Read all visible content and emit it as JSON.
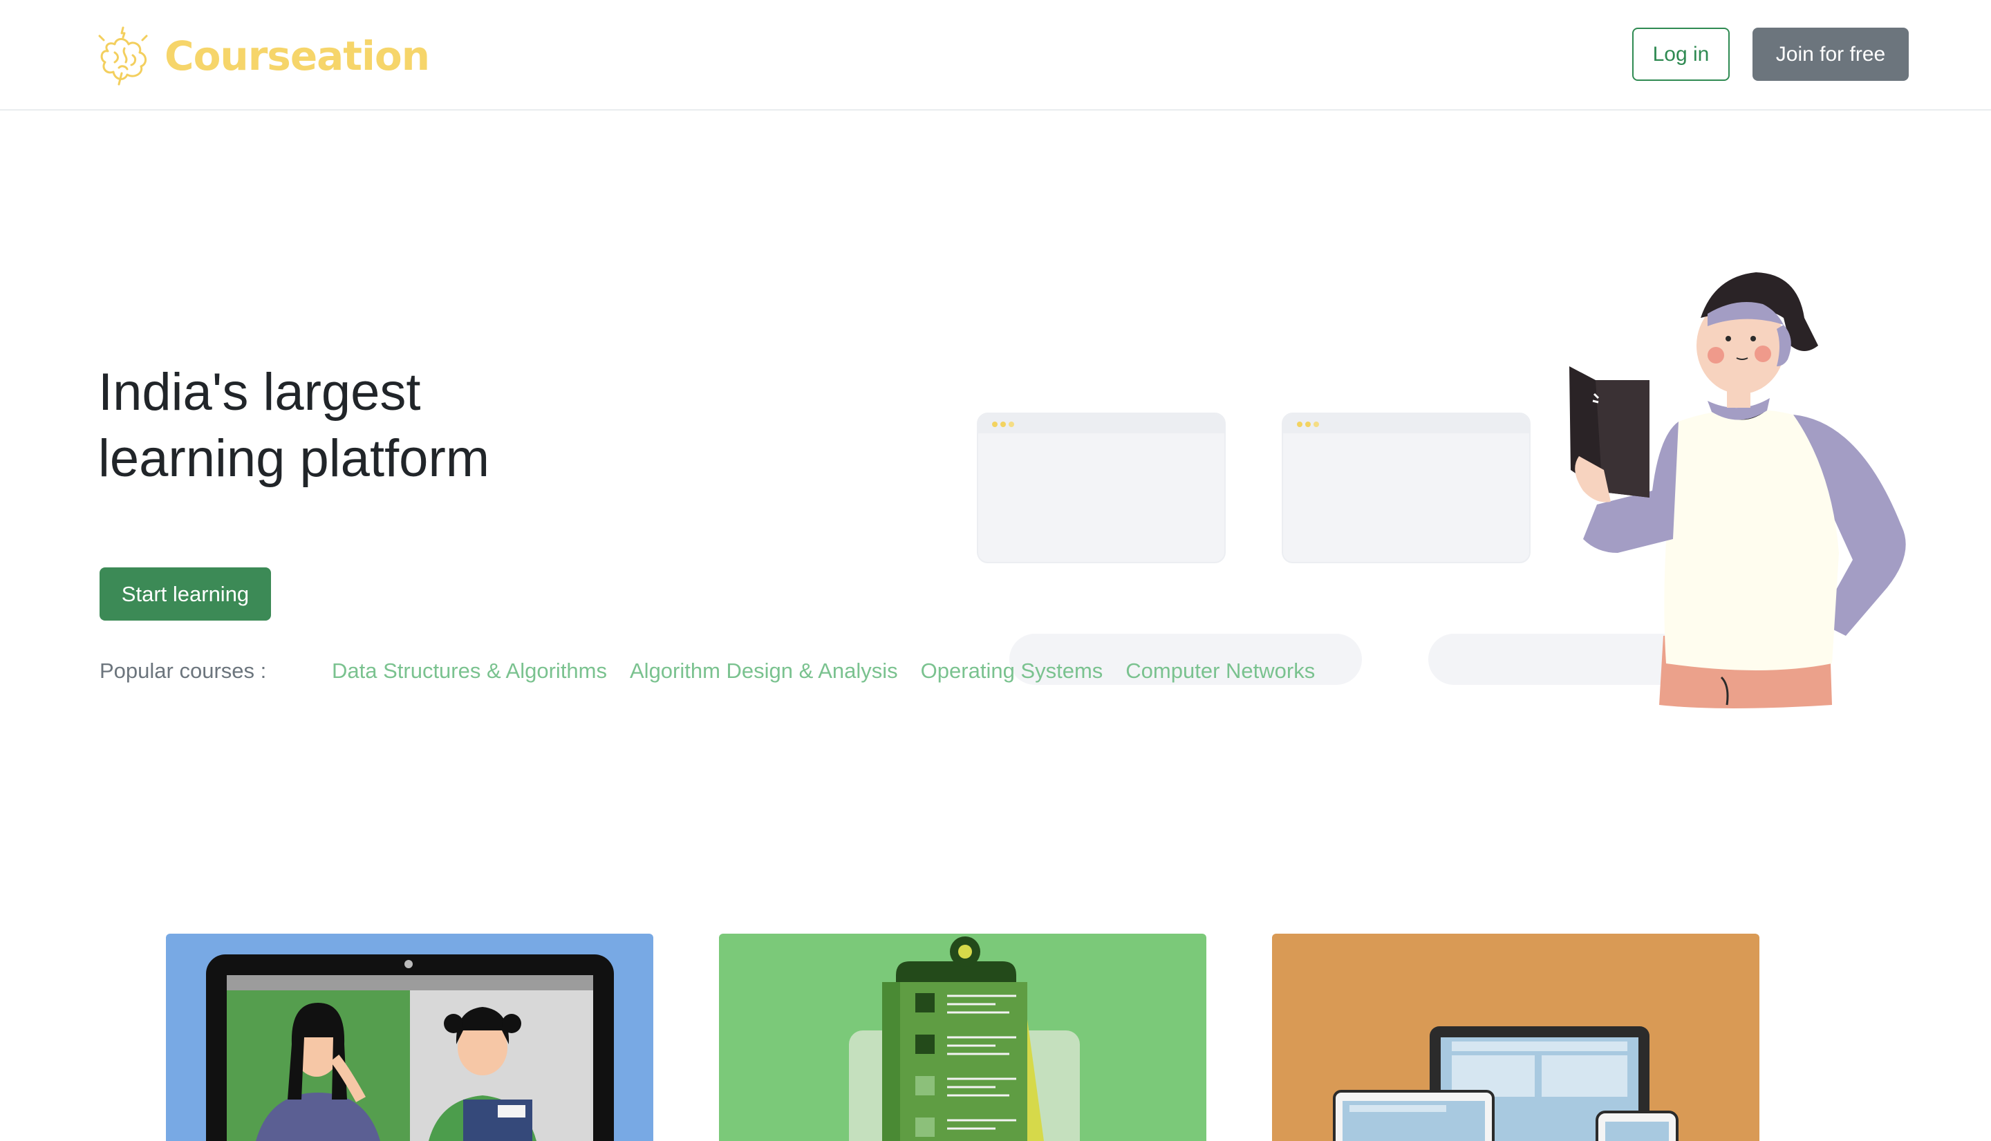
{
  "navbar": {
    "brand": "Courseation",
    "login_label": "Log in",
    "join_label": "Join for free"
  },
  "hero": {
    "title_line1": "India's largest",
    "title_line2": "learning platform",
    "start_label": "Start learning",
    "popular_label": "Popular courses :",
    "courses": [
      "Data Structures & Algorithms",
      "Algorithm Design & Analysis",
      "Operating Systems",
      "Computer Networks"
    ]
  },
  "colors": {
    "brand_yellow": "#f6d56a",
    "primary_green": "#3c8a56",
    "link_green": "#7ac28f",
    "secondary_gray": "#6c757d",
    "card1_bg": "#78a9e4",
    "card2_bg": "#7bc979",
    "card3_bg": "#d99a55"
  },
  "icons": {
    "brand": "brain-icon"
  }
}
